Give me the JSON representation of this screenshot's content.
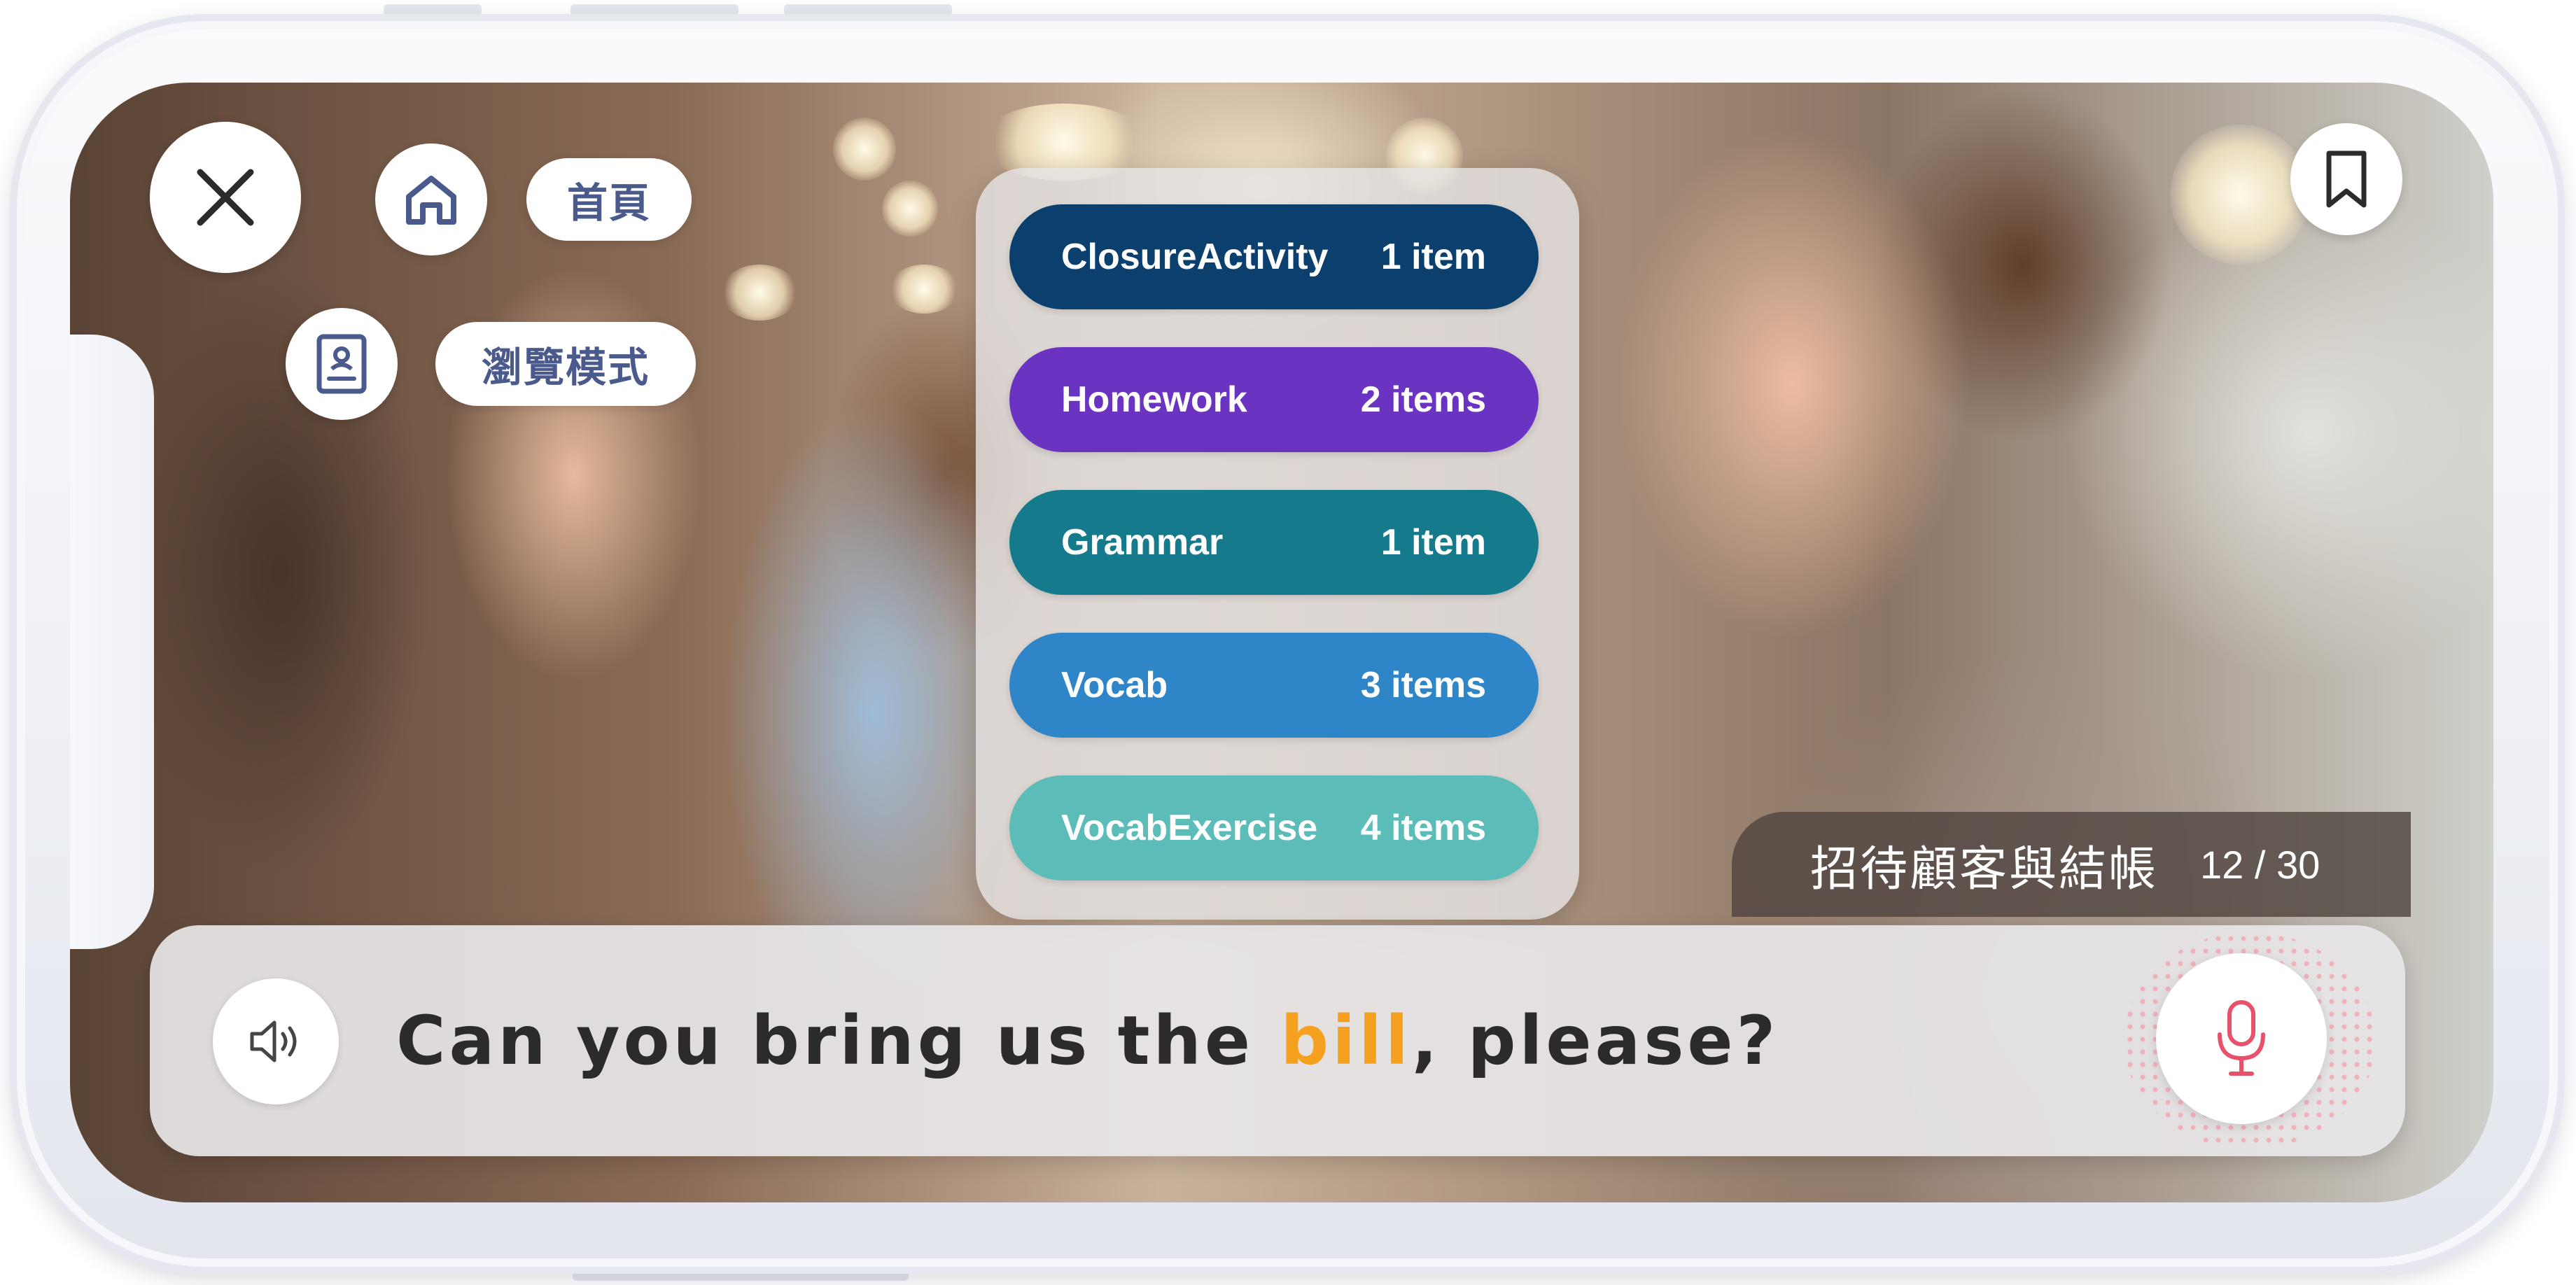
{
  "nav": {
    "home_label": "首頁",
    "browse_label": "瀏覽模式"
  },
  "menu": {
    "items": [
      {
        "label": "ClosureActivity",
        "count": "1 item",
        "color": "#0b3f6e"
      },
      {
        "label": "Homework",
        "count": "2 items",
        "color": "#6b33c2"
      },
      {
        "label": "Grammar",
        "count": "1 item",
        "color": "#157a8c"
      },
      {
        "label": "Vocab",
        "count": "3 items",
        "color": "#2e85c7"
      },
      {
        "label": "VocabExercise",
        "count": "4 items",
        "color": "#5bbcb8"
      }
    ]
  },
  "lesson": {
    "title": "招待顧客與結帳",
    "progress": "12 / 30"
  },
  "sentence": {
    "before": "Can you bring us the ",
    "highlight": "bill",
    "after": ", please?",
    "highlight_color": "#f5a11f"
  },
  "colors": {
    "icon_blue": "#4a5a8c",
    "mic_pink": "#e8506b"
  }
}
